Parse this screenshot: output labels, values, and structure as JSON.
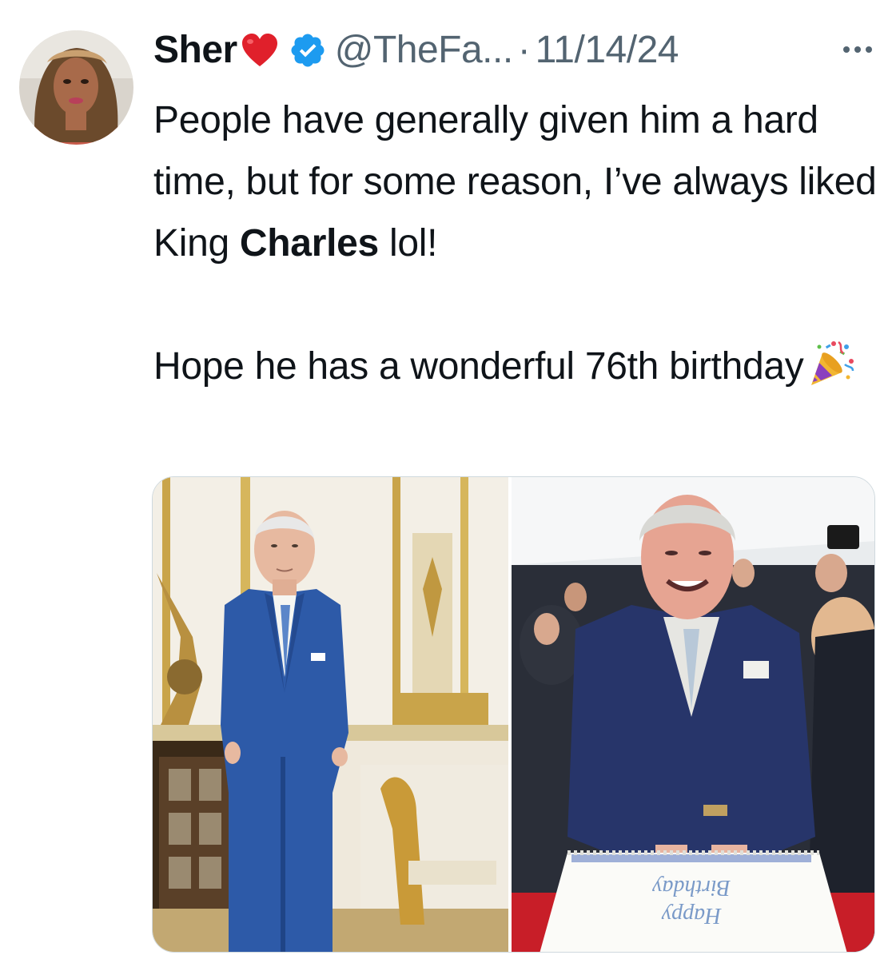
{
  "author": {
    "name": "Sher",
    "handle": "@TheFa...",
    "separator": "·",
    "date": "11/14/24",
    "heart_icon": "red-heart-emoji",
    "verified_icon": "verified-badge-icon"
  },
  "tweet": {
    "paragraph1_before": "People have generally given him a hard time, but for some reason, I’ve always liked King ",
    "paragraph1_bold": "Charles",
    "paragraph1_after": " lol!",
    "paragraph2": "Hope he has a wonderful 76th birthday",
    "emoji": "party-popper-emoji"
  },
  "media": {
    "photos": [
      {
        "name": "portrait-photo"
      },
      {
        "name": "birthday-cake-photo",
        "cake_text": [
          "Birthday",
          "Happy"
        ]
      }
    ]
  },
  "colors": {
    "text": "#0f1419",
    "secondary": "#536471",
    "verified": "#1d9bf0",
    "heart": "#e0202b"
  }
}
